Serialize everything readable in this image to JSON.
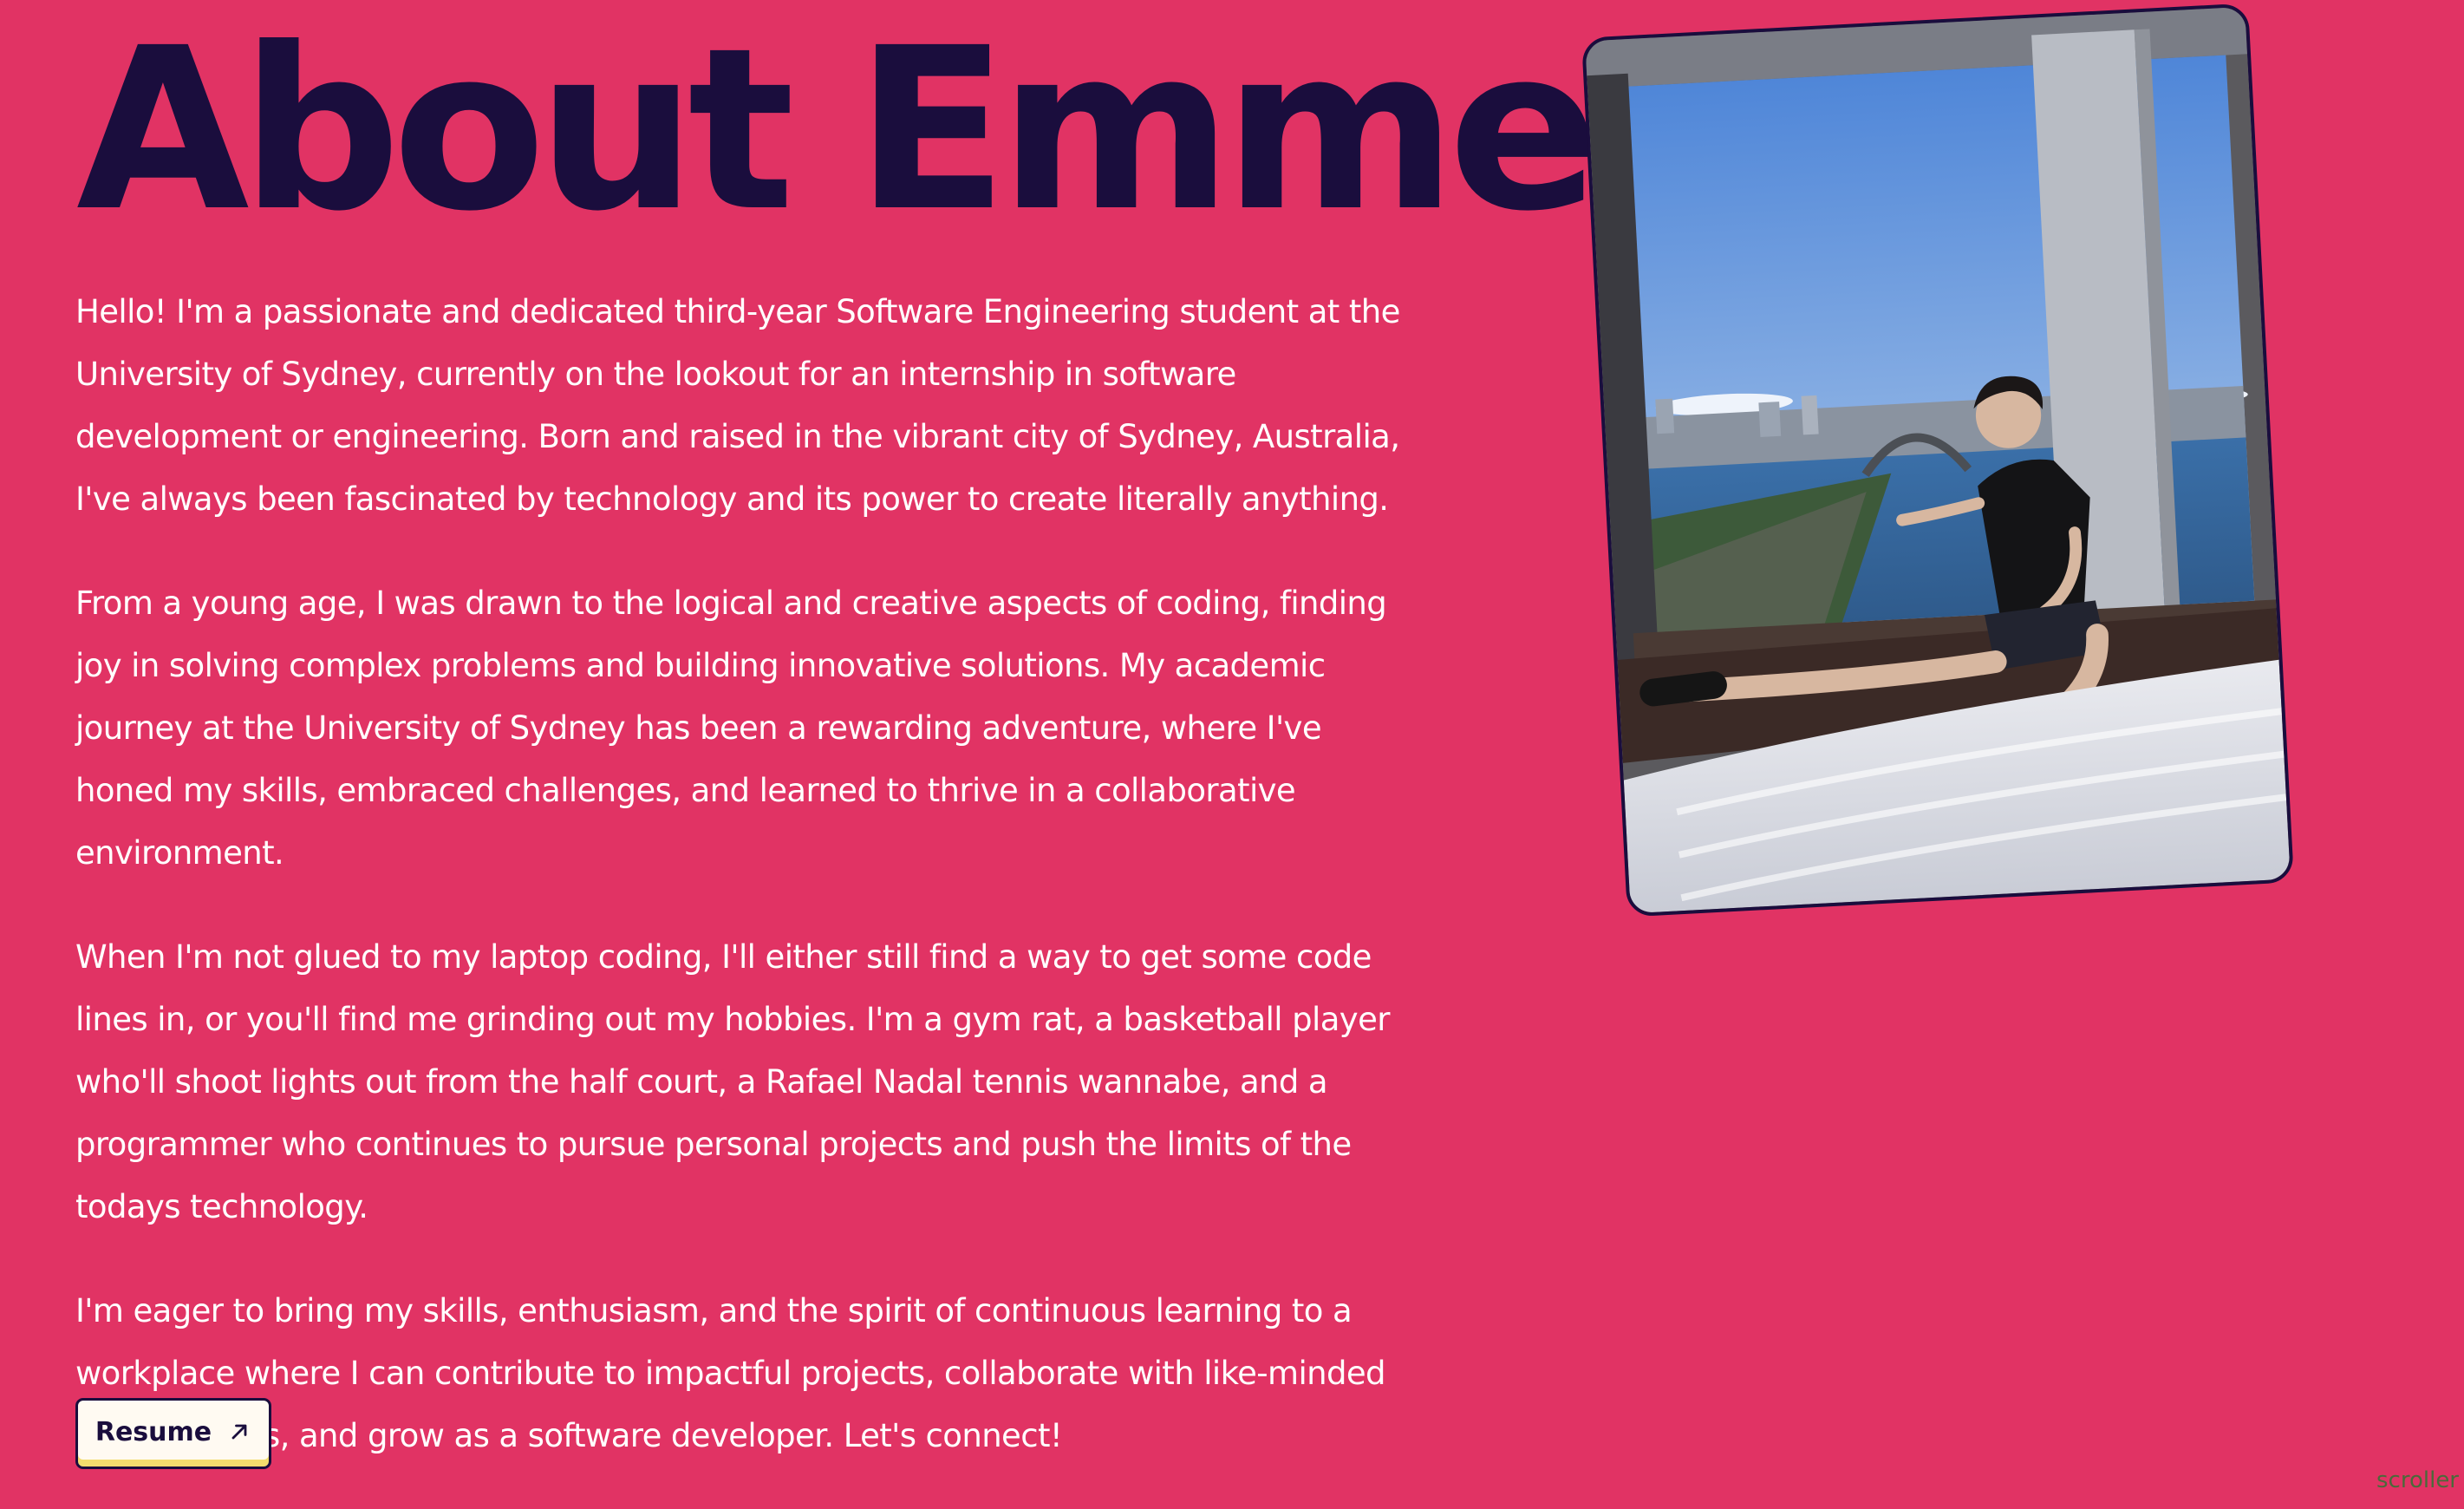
{
  "header": {
    "title": "About Emme"
  },
  "bio": {
    "paragraphs": [
      "Hello! I'm a passionate and dedicated third-year Software Engineering student at the University of Sydney, currently on the lookout for an internship in software development or engineering. Born and raised in the vibrant city of Sydney, Australia, I've always been fascinated by technology and its power to create literally anything.",
      "From a young age, I was drawn to the logical and creative aspects of coding, finding joy in solving complex problems and building innovative solutions. My academic journey at the University of Sydney has been a rewarding adventure, where I've honed my skills, embraced challenges, and learned to thrive in a collaborative environment.",
      "When I'm not glued to my laptop coding, I'll either still find a way to get some code lines in, or you'll find me grinding out my hobbies. I'm a gym rat, a basketball player who'll shoot lights out from the half court, a Rafael Nadal tennis wannabe, and a programmer who continues to pursue personal projects and push the limits of the todays technology.",
      "I'm eager to bring my skills, enthusiasm, and the spirit of continuous learning to a workplace where I can contribute to impactful projects, collaborate with like-minded professionals, and grow as a software developer. Let's connect!"
    ]
  },
  "resume_button": {
    "label": "Resume",
    "icon": "arrow-up-right-icon"
  },
  "watermark": {
    "label": "scroller"
  },
  "colors": {
    "background": "#e13364",
    "title": "#1a0d3d",
    "body_text": "#ffffff",
    "button_bg": "#fffaf2",
    "button_accent": "#f3dd6d"
  }
}
